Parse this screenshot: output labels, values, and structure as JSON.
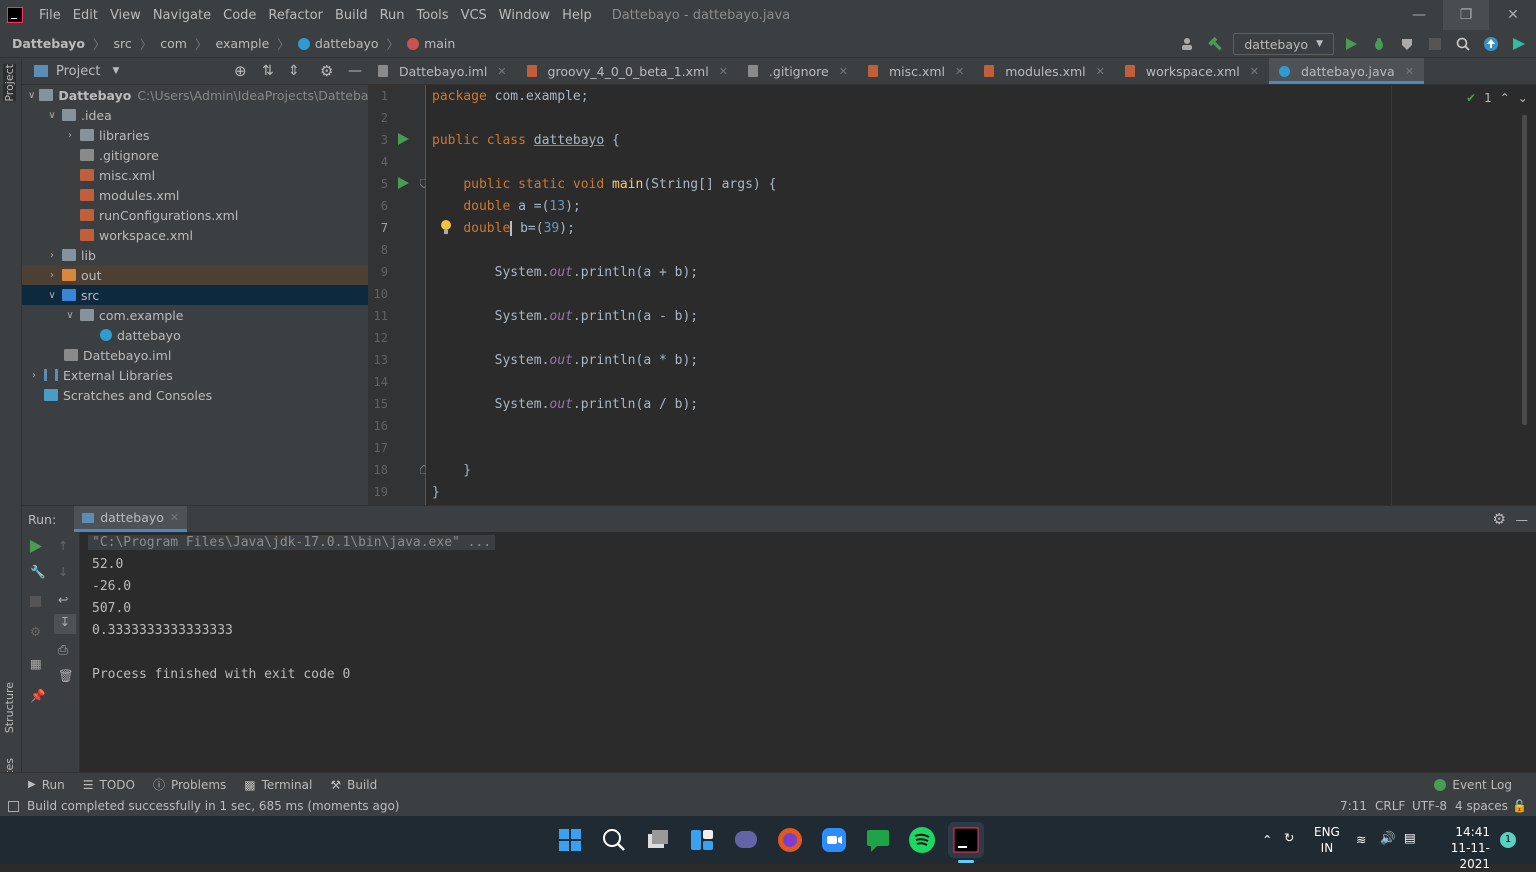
{
  "menubar": {
    "items": [
      "File",
      "Edit",
      "View",
      "Navigate",
      "Code",
      "Refactor",
      "Build",
      "Run",
      "Tools",
      "VCS",
      "Window",
      "Help"
    ],
    "title": "Dattebayo - dattebayo.java"
  },
  "breadcrumb": [
    "Dattebayo",
    "src",
    "com",
    "example",
    "dattebayo",
    "main"
  ],
  "toolbar": {
    "run_config": "dattebayo"
  },
  "project_panel": {
    "title": "Project",
    "tree": [
      {
        "label": "Dattebayo",
        "path": "C:\\Users\\Admin\\IdeaProjects\\Dattebayo",
        "depth": 0,
        "icon": "module-folder-icon",
        "open": true
      },
      {
        "label": ".idea",
        "depth": 1,
        "icon": "folder-icon",
        "open": true
      },
      {
        "label": "libraries",
        "depth": 2,
        "icon": "folder-icon",
        "open": false
      },
      {
        "label": ".gitignore",
        "depth": 2,
        "icon": "gitignore-icon"
      },
      {
        "label": "misc.xml",
        "depth": 2,
        "icon": "xml-icon"
      },
      {
        "label": "modules.xml",
        "depth": 2,
        "icon": "xml-icon"
      },
      {
        "label": "runConfigurations.xml",
        "depth": 2,
        "icon": "xml-icon"
      },
      {
        "label": "workspace.xml",
        "depth": 2,
        "icon": "xml-icon"
      },
      {
        "label": "lib",
        "depth": 1,
        "icon": "folder-icon",
        "open": false
      },
      {
        "label": "out",
        "depth": 1,
        "icon": "excluded-folder-icon",
        "open": false
      },
      {
        "label": "src",
        "depth": 1,
        "icon": "source-folder-icon",
        "open": true
      },
      {
        "label": "com.example",
        "depth": 2,
        "icon": "package-icon",
        "open": true
      },
      {
        "label": "dattebayo",
        "depth": 3,
        "icon": "java-class-icon"
      },
      {
        "label": "Dattebayo.iml",
        "depth": 1,
        "icon": "iml-icon"
      },
      {
        "label": "External Libraries",
        "depth": 0,
        "icon": "library-icon",
        "open": false
      },
      {
        "label": "Scratches and Consoles",
        "depth": 0,
        "icon": "scratch-icon"
      }
    ]
  },
  "tabs": [
    "Dattebayo.iml",
    "groovy_4_0_0_beta_1.xml",
    ".gitignore",
    "misc.xml",
    "modules.xml",
    "workspace.xml",
    "dattebayo.java"
  ],
  "editor": {
    "inspection_count": "1",
    "line_numbers": [
      "1",
      "2",
      "3",
      "4",
      "5",
      "6",
      "7",
      "8",
      "9",
      "10",
      "11",
      "12",
      "13",
      "14",
      "15",
      "16",
      "17",
      "18",
      "19"
    ]
  },
  "run_panel": {
    "label": "Run:",
    "tab": "dattebayo",
    "output": [
      "\"C:\\Program Files\\Java\\jdk-17.0.1\\bin\\java.exe\" ...",
      "52.0",
      "-26.0",
      "507.0",
      "0.3333333333333333",
      "",
      "Process finished with exit code 0"
    ]
  },
  "bottom_tools": [
    "Run",
    "TODO",
    "Problems",
    "Terminal",
    "Build"
  ],
  "event_log": "Event Log",
  "status": {
    "message": "Build completed successfully in 1 sec, 685 ms (moments ago)",
    "position": "7:11",
    "line_sep": "CRLF",
    "encoding": "UTF-8",
    "indent": "4 spaces"
  },
  "taskbar": {
    "lang1": "ENG",
    "lang2": "IN",
    "time": "14:41",
    "date": "11-11-2021",
    "notif": "1"
  },
  "colors": {
    "accent": "#4a88c7",
    "keyword": "#cc7832",
    "number": "#6897bb",
    "function": "#ffc66d",
    "run_green": "#499c54"
  }
}
